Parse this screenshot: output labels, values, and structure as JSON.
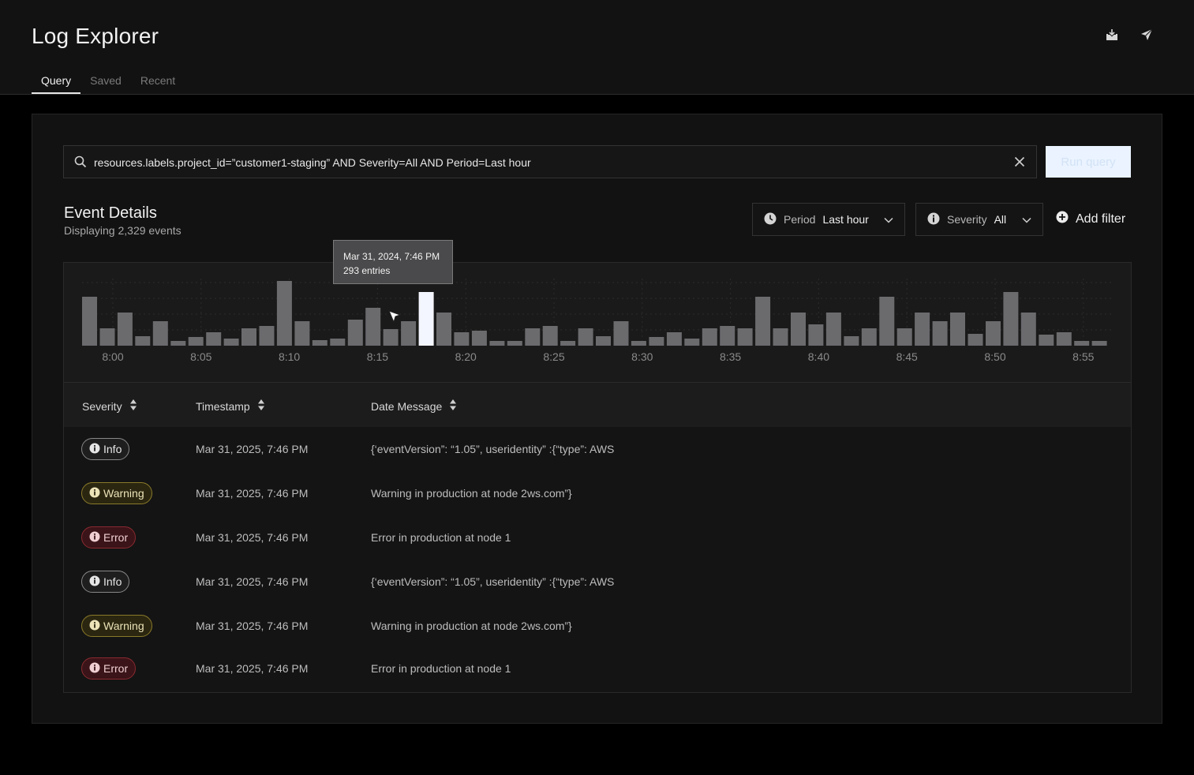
{
  "app": {
    "title": "Log Explorer"
  },
  "tabs": [
    {
      "label": "Query",
      "active": true
    },
    {
      "label": "Saved",
      "active": false
    },
    {
      "label": "Recent",
      "active": false
    }
  ],
  "icons": {
    "download": "download-icon",
    "send": "send-icon",
    "search": "search-icon",
    "clear": "close-icon",
    "period": "clock-icon",
    "severity": "info-icon",
    "add_filter": "plus-circle-icon",
    "chevron": "chevron-down-icon",
    "sort": "sort-icon"
  },
  "search": {
    "value": "resources.labels.project_id=”customer1-staging” AND Severity=All AND Period=Last hour",
    "run_label": "Run query"
  },
  "section": {
    "title": "Event Details",
    "subtitle": "Displaying 2,329 events"
  },
  "filters": {
    "period_label": "Period",
    "period_value": "Last hour",
    "severity_label": "Severity",
    "severity_value": "All",
    "add_label": "Add filter"
  },
  "chart_data": {
    "type": "bar",
    "x_ticks": [
      "8:00",
      "8:05",
      "8:10",
      "8:15",
      "8:20",
      "8:25",
      "8:30",
      "8:35",
      "8:40",
      "8:45",
      "8:50",
      "8:55"
    ],
    "values": [
      62,
      22,
      42,
      12,
      31,
      6,
      11,
      17,
      9,
      22,
      25,
      82,
      31,
      7,
      9,
      33,
      48,
      21,
      31,
      68,
      42,
      17,
      19,
      6,
      6,
      22,
      25,
      6,
      22,
      12,
      31,
      6,
      11,
      17,
      9,
      22,
      25,
      22,
      62,
      22,
      42,
      27,
      42,
      12,
      22,
      62,
      22,
      42,
      31,
      42,
      15,
      31,
      68,
      42,
      14,
      17,
      6,
      6
    ],
    "highlight_index": 19,
    "grid": true,
    "tooltip": {
      "date": "Mar 31, 2024, 7:46 PM",
      "entries": "293 entries"
    },
    "colors": {
      "bar": "#6b6b6e",
      "highlight": "#f4f6ff"
    }
  },
  "table": {
    "columns": [
      "Severity",
      "Timestamp",
      "Date Message"
    ],
    "rows": [
      {
        "severity": "Info",
        "level": "info",
        "timestamp": "Mar 31, 2025, 7:46 PM",
        "message": "{‘eventVersion”: “1.05”, useridentity” :{“type”: AWS"
      },
      {
        "severity": "Warning",
        "level": "warning",
        "timestamp": "Mar 31, 2025, 7:46 PM",
        "message": "Warning in production at node 2ws.com”}"
      },
      {
        "severity": "Error",
        "level": "error",
        "timestamp": "Mar 31, 2025, 7:46 PM",
        "message": "Error in production at node 1"
      },
      {
        "severity": "Info",
        "level": "info",
        "timestamp": "Mar 31, 2025, 7:46 PM",
        "message": "{‘eventVersion”: “1.05”, useridentity” :{“type”: AWS"
      },
      {
        "severity": "Warning",
        "level": "warning",
        "timestamp": "Mar 31, 2025, 7:46 PM",
        "message": "Warning in production at node 2ws.com”}"
      },
      {
        "severity": "Error",
        "level": "error",
        "timestamp": "Mar 31, 2025, 7:46 PM",
        "message": "Error in production at node 1"
      }
    ]
  }
}
